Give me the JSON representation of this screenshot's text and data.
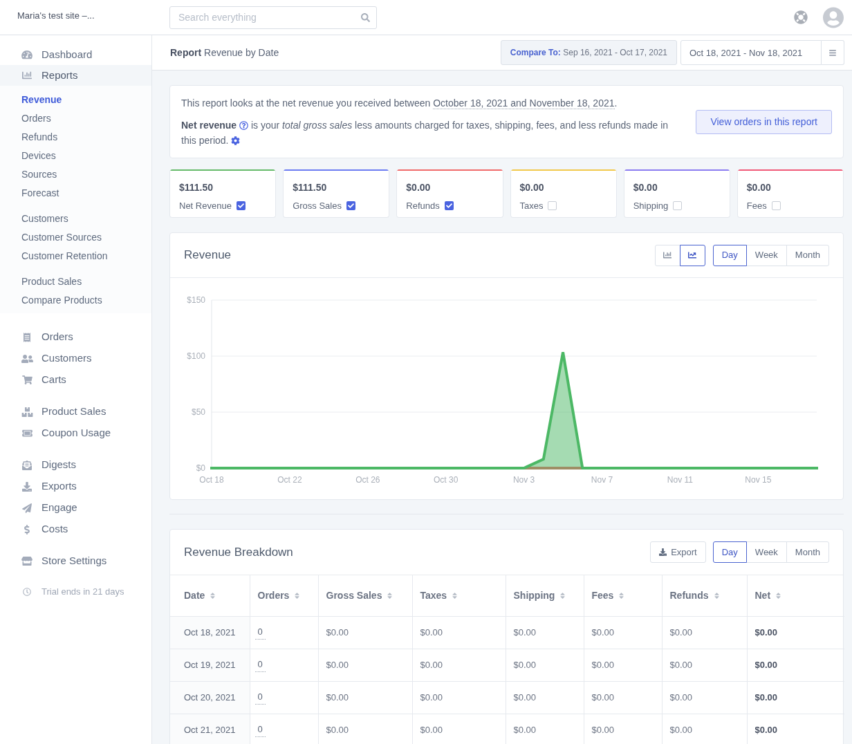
{
  "topbar": {
    "site_name": "Maria's test site –...",
    "search": {
      "placeholder": "Search everything"
    }
  },
  "sidebar": {
    "primary": [
      {
        "label": "Dashboard",
        "selected": false
      },
      {
        "label": "Reports",
        "selected": true,
        "expanded": true,
        "children": [
          {
            "items": [
              {
                "label": "Revenue",
                "selected": true
              },
              {
                "label": "Orders",
                "selected": false
              },
              {
                "label": "Refunds",
                "selected": false
              },
              {
                "label": "Devices",
                "selected": false
              },
              {
                "label": "Sources",
                "selected": false
              },
              {
                "label": "Forecast",
                "selected": false
              }
            ]
          },
          {
            "items": [
              {
                "label": "Customers",
                "selected": false
              },
              {
                "label": "Customer Sources",
                "selected": false
              },
              {
                "label": "Customer Retention",
                "selected": false
              }
            ]
          },
          {
            "items": [
              {
                "label": "Product Sales",
                "selected": false
              },
              {
                "label": "Compare Products",
                "selected": false
              }
            ]
          }
        ]
      }
    ],
    "groups": [
      {
        "items": [
          {
            "label": "Orders",
            "selected": false
          },
          {
            "label": "Customers",
            "selected": false
          },
          {
            "label": "Carts",
            "selected": false
          }
        ]
      },
      {
        "items": [
          {
            "label": "Product Sales",
            "selected": false
          },
          {
            "label": "Coupon Usage",
            "selected": false
          }
        ]
      },
      {
        "items": [
          {
            "label": "Digests",
            "selected": false
          },
          {
            "label": "Exports",
            "selected": false
          },
          {
            "label": "Engage",
            "selected": false
          },
          {
            "label": "Costs",
            "selected": false
          }
        ]
      },
      {
        "items": [
          {
            "label": "Store Settings",
            "selected": false
          }
        ]
      }
    ],
    "trial_note": "Trial ends in 21 days"
  },
  "report_header": {
    "title": "**Report** Revenue by Date",
    "compare": {
      "label": "Compare To:",
      "range": "Sep 16, 2021 - Oct 17, 2021"
    },
    "date_range": {
      "value": "Oct 18, 2021 - Nov 18, 2021"
    }
  },
  "summary": {
    "lead": "This report looks at the net revenue you received between",
    "date_span": "October 18, 2021 and November 18, 2021",
    "end": ".",
    "term": "Net revenue",
    "definition": "is your *total gross sales* less amounts charged for taxes, shipping, fees, and less refunds made in this period.",
    "button": "View orders in this report"
  },
  "metrics": [
    {
      "value": "$111.50",
      "label": "Net Revenue",
      "checked": true,
      "color": "#66bb6a"
    },
    {
      "value": "$111.50",
      "label": "Gross Sales",
      "checked": true,
      "color": "#6c7cf2"
    },
    {
      "value": "$0.00",
      "label": "Refunds",
      "checked": true,
      "color": "#f06b6b"
    },
    {
      "value": "$0.00",
      "label": "Taxes",
      "checked": false,
      "color": "#f2c94c"
    },
    {
      "value": "$0.00",
      "label": "Shipping",
      "checked": false,
      "color": "#8b7cf0"
    },
    {
      "value": "$0.00",
      "label": "Fees",
      "checked": false,
      "color": "#f05a78"
    }
  ],
  "revenue_chart": {
    "title": "Revenue",
    "chart_types": [
      {
        "kind": "bar",
        "selected": false
      },
      {
        "kind": "line",
        "selected": true
      }
    ],
    "periods": [
      {
        "label": "Day",
        "selected": true
      },
      {
        "label": "Week",
        "selected": false
      },
      {
        "label": "Month",
        "selected": false
      }
    ],
    "chart_data": {
      "type": "area",
      "categories": [
        "Oct 18",
        null,
        null,
        null,
        "Oct 22",
        null,
        null,
        null,
        "Oct 26",
        null,
        null,
        null,
        "Oct 30",
        null,
        null,
        null,
        "Nov 3",
        null,
        null,
        null,
        "Nov 7",
        null,
        null,
        null,
        "Nov 11",
        null,
        null,
        null,
        "Nov 15",
        null,
        null,
        null
      ],
      "series": [
        {
          "color": "#4cb865",
          "values": [
            0,
            0,
            0,
            0,
            0,
            0,
            0,
            0,
            0,
            0,
            0,
            0,
            0,
            0,
            0,
            0,
            0,
            8,
            103.5,
            0,
            0,
            0,
            0,
            0,
            0,
            0,
            0,
            0,
            0,
            0,
            0,
            0
          ]
        },
        {
          "color": "#f06464",
          "values": [
            0,
            0,
            0,
            0,
            0,
            0,
            0,
            0,
            0,
            0,
            0,
            0,
            0,
            0,
            0,
            0,
            0,
            0,
            0,
            0,
            0,
            0,
            0,
            0,
            0,
            0,
            0,
            0,
            0,
            0,
            0,
            0
          ]
        }
      ],
      "ylim": [
        0,
        150
      ],
      "yticks": [
        {
          "value": 0,
          "label": "$0"
        },
        {
          "value": 50,
          "label": "$50"
        },
        {
          "value": 100,
          "label": "$100"
        },
        {
          "value": 150,
          "label": "$150"
        }
      ]
    }
  },
  "breakdown": {
    "title": "Revenue Breakdown",
    "export_label": "Export",
    "periods": [
      {
        "label": "Day",
        "selected": true
      },
      {
        "label": "Week",
        "selected": false
      },
      {
        "label": "Month",
        "selected": false
      }
    ],
    "table": {
      "columns": [
        {
          "label": "Date",
          "kind": "date"
        },
        {
          "label": "Orders",
          "kind": "link"
        },
        {
          "label": "Gross Sales",
          "kind": "amount"
        },
        {
          "label": "Taxes",
          "kind": "amount"
        },
        {
          "label": "Shipping",
          "kind": "amount"
        },
        {
          "label": "Fees",
          "kind": "amount"
        },
        {
          "label": "Refunds",
          "kind": "amount"
        },
        {
          "label": "Net",
          "kind": "total"
        }
      ],
      "rows": [
        [
          "Oct 18, 2021",
          "0",
          "$0.00",
          "$0.00",
          "$0.00",
          "$0.00",
          "$0.00",
          "$0.00"
        ],
        [
          "Oct 19, 2021",
          "0",
          "$0.00",
          "$0.00",
          "$0.00",
          "$0.00",
          "$0.00",
          "$0.00"
        ],
        [
          "Oct 20, 2021",
          "0",
          "$0.00",
          "$0.00",
          "$0.00",
          "$0.00",
          "$0.00",
          "$0.00"
        ],
        [
          "Oct 21, 2021",
          "0",
          "$0.00",
          "$0.00",
          "$0.00",
          "$0.00",
          "$0.00",
          "$0.00"
        ]
      ]
    }
  }
}
